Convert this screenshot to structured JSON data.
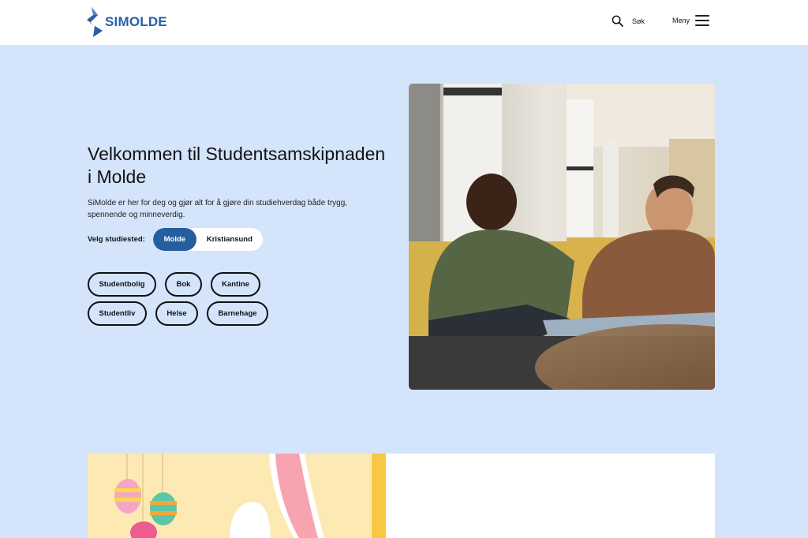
{
  "header": {
    "logo_text": "SIMOLDE",
    "logo_icon": "simolde-logo-icon",
    "search_label": "Søk",
    "menu_label": "Meny"
  },
  "hero": {
    "title": "Velkommen til Studentsamskipnaden i Molde",
    "description": "SiMolde er her for deg og gjør alt for å gjøre din studiehverdag både trygg, spennende og minneverdig.",
    "study_place_label": "Velg studiested:",
    "study_places": [
      "Molde",
      "Kristiansund"
    ],
    "selected_study_place": "Molde"
  },
  "chips": {
    "row1": [
      "Studentbolig",
      "Bok",
      "Kantine"
    ],
    "row2": [
      "Studentliv",
      "Helse",
      "Barnehage"
    ]
  },
  "colors": {
    "background": "#d3e4fb",
    "primary": "#245e9e",
    "logo_blue": "#2a5fa8"
  }
}
